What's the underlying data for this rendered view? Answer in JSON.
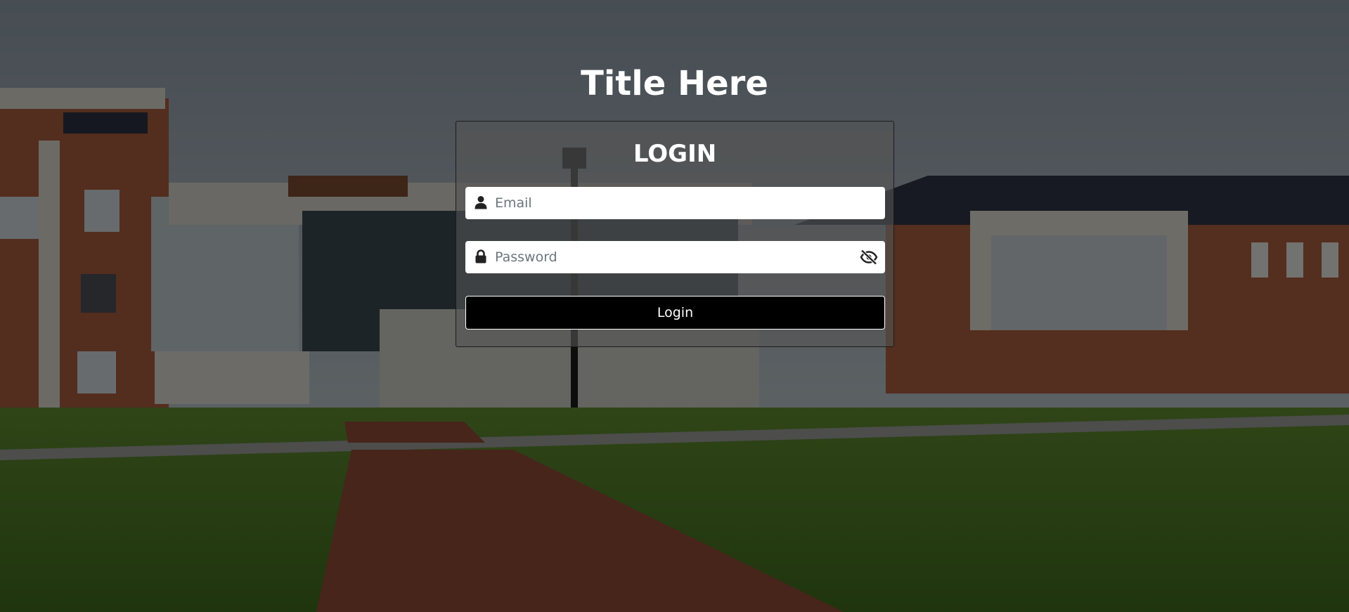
{
  "page": {
    "title": "Title Here"
  },
  "login_form": {
    "heading": "LOGIN",
    "email": {
      "value": "",
      "placeholder": "Email",
      "icon": "user-icon"
    },
    "password": {
      "value": "",
      "placeholder": "Password",
      "icon": "lock-icon",
      "toggle_icon": "eye-slash-icon"
    },
    "submit_label": "Login"
  },
  "colors": {
    "overlay": "#000000",
    "card_background": "#555555",
    "button_background": "#000000",
    "button_border": "#ffffff",
    "text_light": "#ffffff",
    "placeholder": "#6c757d"
  },
  "background_scene": {
    "icon": "campus-photo"
  }
}
